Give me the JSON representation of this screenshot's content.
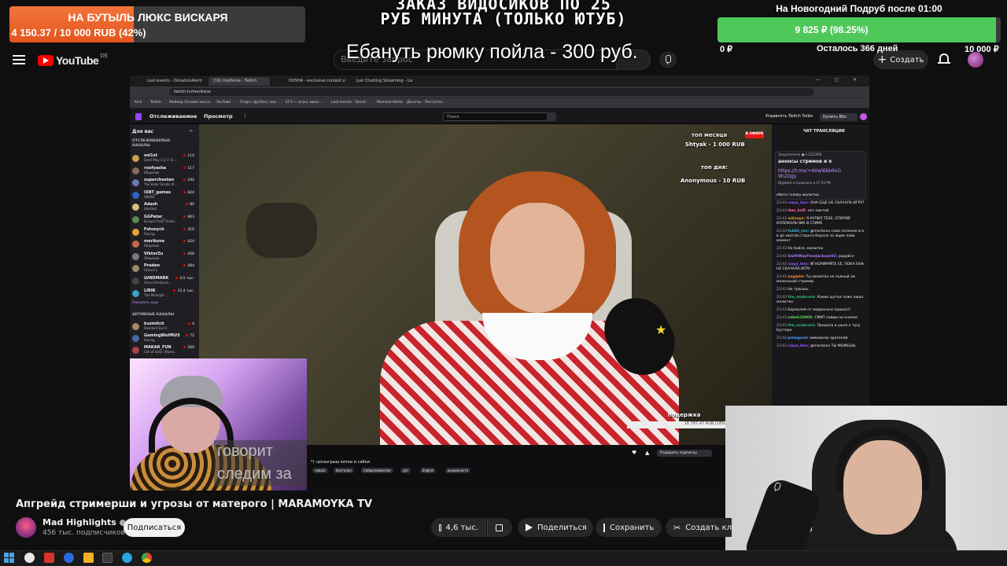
{
  "overlay": {
    "donation_goal": {
      "title": "НА БУТЫЛЬ ЛЮКС ВИСКАРЯ",
      "amount": "4 150.37 / 10 000 RUB (42%)",
      "progress": 0.42
    },
    "tts_title": "ЗАКАЗ ВИДОСИКОВ ПО 25 РУБ МИНУТА (ТОЛЬКО ЮТУБ)",
    "pinned_text": "Ебануть рюмку пойла - 300 руб.",
    "sub_goal": {
      "title": "На Новогодний Подруб после 01:00",
      "amount": "9 825 ₽ (98.25%)",
      "min": "0 ₽",
      "remaining": "Осталось 366 дней",
      "max": "10 000 ₽",
      "progress": 0.9825
    },
    "caption": "говорит следим за"
  },
  "youtube": {
    "logo_text": "YouTube",
    "region": "DE",
    "search_placeholder": "Введите запрос",
    "create_label": "Создать",
    "video_title": "Апгрейд стримерши и угрозы от матерого | MARAMOYKA TV",
    "channel_name": "Mad Highlights",
    "channel_subs": "456 тыс. подписчиков",
    "subscribe_label": "Подписаться",
    "likes": "4,6 тыс.",
    "share_label": "Поделиться",
    "save_label": "Сохранить",
    "clip_label": "Создать клип"
  },
  "browser": {
    "tabs": [
      {
        "label": "Last events - DonationAlerts"
      },
      {
        "label": "(19) meriksne - Twitch"
      },
      {
        "label": "DOSHA - exclusive content on"
      },
      {
        "label": "Just Chatting Streaming - Live"
      }
    ],
    "url": "twitch.tv/meriksne",
    "bookmarks": [
      "Kick",
      "Twitch",
      "Мейкер Онлайн-касса",
      "YouTube",
      "Спорт, футбол, хок...",
      "ЕГЭ — игры, кино...",
      "Last events - Donat...",
      "Moment Alerts",
      "Донаты - Поступле..."
    ]
  },
  "twitch": {
    "nav_following": "Отслеживаемое",
    "nav_browse": "Просмотр",
    "search_placeholder": "Поиск",
    "turbo_label": "Управлять Twitch Turbo",
    "bits_label": "Купить Bits",
    "sidebar_title": "Для вас",
    "followed_section": "ОТСЛЕЖИВАЕМЫЕ КАНАЛЫ",
    "followed": [
      {
        "name": "sol1st",
        "category": "Devil May Cry 3: D...",
        "viewers": "114",
        "color": "#c9a24a"
      },
      {
        "name": "roofyasha",
        "category": "Общение",
        "viewers": "117",
        "color": "#8a6a5a"
      },
      {
        "name": "superchestan",
        "category": "The Elder Scrolls IV...",
        "viewers": "192",
        "color": "#6a7ab0"
      },
      {
        "name": "IXBT_games",
        "category": "XBOX0",
        "viewers": "824",
        "color": "#2a64c8"
      },
      {
        "name": "Adash",
        "category": "StarRed",
        "viewers": "80",
        "color": "#d4c07a"
      },
      {
        "name": "GGPater_",
        "category": "Escape From Tarkov",
        "viewers": "903",
        "color": "#5a8a4a"
      },
      {
        "name": "Fotonych",
        "category": "Racing",
        "viewers": "316",
        "color": "#e8a23a"
      },
      {
        "name": "meriksne",
        "category": "Общение",
        "viewers": "424",
        "color": "#c8684a"
      },
      {
        "name": "ViktorZu",
        "category": "Общение",
        "viewers": "456",
        "color": "#7a7a7a"
      },
      {
        "name": "Praden",
        "category": "Fallout 2",
        "viewers": "484",
        "color": "#9a8a6a"
      },
      {
        "name": "LVNDMARK",
        "category": "Arena Breakout...",
        "viewers": "4,5 тыс.",
        "color": "#444444"
      },
      {
        "name": "LIRIK",
        "category": "The Midnight ...",
        "viewers": "12,4 тыс.",
        "color": "#3aa0c8"
      }
    ],
    "show_more": "Показать еще",
    "active_section": "АКТИВНЫЕ КАНАЛЫ",
    "active": [
      {
        "name": "kuzmitch",
        "category": "Resident Evil 4",
        "viewers": "4",
        "color": "#aa8866"
      },
      {
        "name": "GamingWolfRUS",
        "category": "Racing",
        "viewers": "72",
        "color": "#4a6aaa"
      },
      {
        "name": "MAKAR_FUN",
        "category": "Call of Duty: Warzo...",
        "viewers": "269",
        "color": "#aa4444"
      }
    ],
    "video_overlay": {
      "top_month": "топ месяца",
      "live": "В ЭФИРЕ",
      "top_month_entry": "Shtyak - 1 000 RUB",
      "top_day": "топ дня:",
      "top_day_entry": "Anonymous - 10 RUB",
      "support": "подержка",
      "support_amount": "16 787.47 RUB (18%"
    },
    "stream_title": "*) «розыгрыш китки и сабки",
    "tags": [
      "няшка",
      "болталка",
      "Сибирскийкотик",
      "girl",
      "English",
      "рыжикнастя"
    ],
    "subscribe_label": "Подарить подписку",
    "chat_title": "ЧАТ ТРАНСЛЯЦИИ",
    "pinned": {
      "who": "Закреплено ● k1Z23RB",
      "text": "анонсы стримов и я",
      "link": "https://t.me/+AVwl6kb6oG 9h2Dgy",
      "foot": "Nightbot отправлено в 07:43 PM"
    },
    "chat": [
      {
        "time": "",
        "user": "",
        "color": "#efeff1",
        "text": "ебите голову малютки"
      },
      {
        "time": "23:43",
        "user": "viaya_lmn",
        "color": "#9c5cff",
        "text": "ОНА ЕЩЕ НЕ СКАЧАЛА ИГРУ?"
      },
      {
        "time": "23:43",
        "user": "Ник_koff",
        "color": "#ff69b4",
        "text": "нет никтой"
      },
      {
        "time": "23:43",
        "user": "wikzaye",
        "color": "#e0a030",
        "text": "Я КУПИЛ ТЕБЕ, ОТКРОЙ КОЛОКОЛЬЧИК В СТИМЕ"
      },
      {
        "time": "23:43",
        "user": "fu666_rex",
        "color": "#38b8d8",
        "text": "@meriksne сама полезем его в до хватай старого Короля за ящик лови момент"
      },
      {
        "time": "23:43",
        "user": "",
        "color": "#ff4b4b",
        "text": "Не бойся, малютка"
      },
      {
        "time": "23:43",
        "user": "SwiftWayFlowJackson92",
        "color": "#b077ff",
        "text": "радуйся"
      },
      {
        "time": "23:43",
        "user": "viaya_lmn",
        "color": "#9c5cff",
        "text": "ИГНОРИРУЙТЕ ЕЁ, ПОКА ОНА НЕ СКАЧАЛА ИГРУ"
      },
      {
        "time": "23:43",
        "user": "yagipke",
        "color": "#ff8c3a",
        "text": "Ты малютка не пьяный ли маленький стример"
      },
      {
        "time": "23:43",
        "user": "",
        "color": "#ff4b4b",
        "text": "Не трясись"
      },
      {
        "time": "23:43",
        "user": "the_exabcore",
        "color": "#2fbf71",
        "text": "Какие шутки тоже наша малютка"
      },
      {
        "time": "23:43",
        "user": "",
        "color": "#ff6a6a",
        "text": "Бармалей от медиасена пришел?"
      },
      {
        "time": "23:43",
        "user": "sebek10000",
        "color": "#5ad85a",
        "text": "СМИТ найди на кнопке"
      },
      {
        "time": "23:43",
        "user": "the_exabcore",
        "color": "#2fbf71",
        "text": "Продала и ушла к тусу Бустера"
      },
      {
        "time": "23:43",
        "user": "primgond",
        "color": "#4aa3ff",
        "text": "мимовалю зрителей"
      },
      {
        "time": "23:43",
        "user": "viaya_lmn",
        "color": "#9c5cff",
        "text": "@meriksne ТЫ МОЖЕШЬ"
      }
    ]
  }
}
